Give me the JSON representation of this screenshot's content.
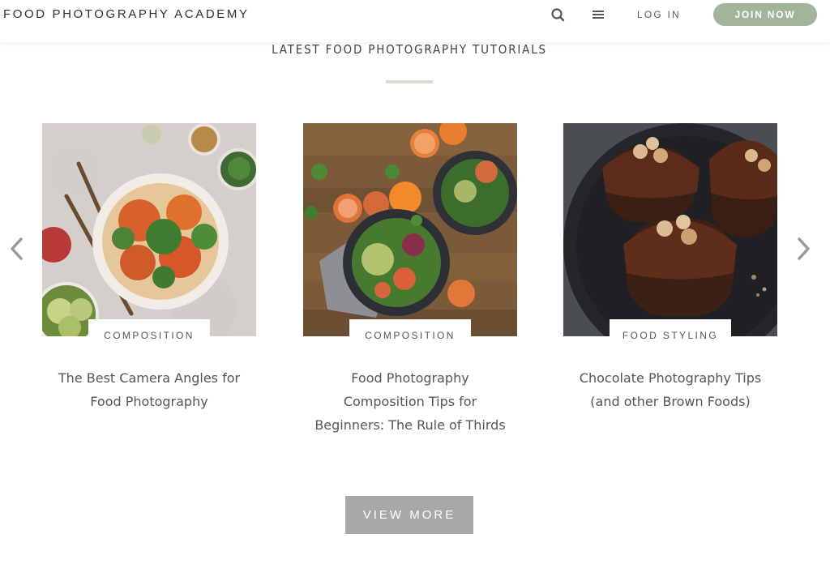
{
  "header": {
    "logo": "FOOD PHOTOGRAPHY ACADEMY",
    "login_label": "LOG IN",
    "join_label": "JOIN NOW",
    "search_icon": "search-icon",
    "menu_icon": "hamburger-menu-icon"
  },
  "section": {
    "title": "LATEST FOOD PHOTOGRAPHY TUTORIALS"
  },
  "cards": [
    {
      "category": "COMPOSITION",
      "title_lines": [
        "The Best Camera Angles for",
        "Food Photography"
      ]
    },
    {
      "category": "COMPOSITION",
      "title_lines": [
        "Food Photography",
        "Composition Tips for",
        "Beginners: The Rule of Thirds"
      ]
    },
    {
      "category": "FOOD STYLING",
      "title_lines": [
        "Chocolate Photography Tips",
        "(and other Brown Foods)"
      ]
    }
  ],
  "carousel": {
    "prev_icon": "chevron-left-icon",
    "next_icon": "chevron-right-icon"
  },
  "view_more_label": "VIEW MORE",
  "colors": {
    "accent_green": "#a3b598",
    "button_gray": "#a8a8a8",
    "text_gray": "#555555"
  }
}
